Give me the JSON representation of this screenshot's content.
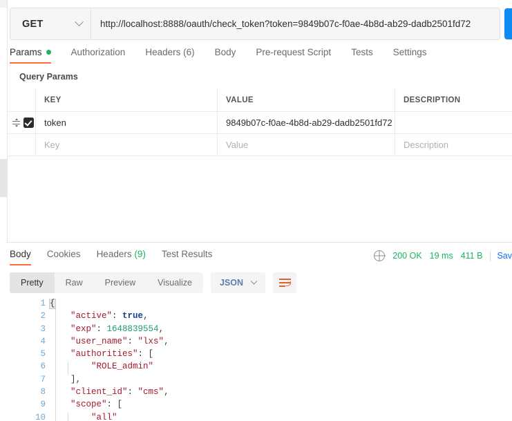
{
  "request": {
    "method": "GET",
    "method_icon": "chevron-down-icon",
    "url": "http://localhost:8888/oauth/check_token?token=9849b07c-f0ae-4b8d-ab29-dadb2501fd72",
    "send_label": "",
    "tabs": [
      {
        "label": "Params",
        "active": true,
        "indicator": "green-dot"
      },
      {
        "label": "Authorization",
        "active": false
      },
      {
        "label": "Headers (6)",
        "active": false
      },
      {
        "label": "Body",
        "active": false
      },
      {
        "label": "Pre-request Script",
        "active": false
      },
      {
        "label": "Tests",
        "active": false
      },
      {
        "label": "Settings",
        "active": false
      }
    ],
    "section_title": "Query Params",
    "params_table": {
      "columns": [
        "KEY",
        "VALUE",
        "DESCRIPTION"
      ],
      "rows": [
        {
          "checked": true,
          "key": "token",
          "value": "9849b07c-f0ae-4b8d-ab29-dadb2501fd72",
          "description": ""
        }
      ],
      "placeholder_row": {
        "key": "Key",
        "value": "Value",
        "description": "Description"
      }
    }
  },
  "response": {
    "tabs": [
      {
        "label": "Body",
        "active": true
      },
      {
        "label": "Cookies",
        "active": false
      },
      {
        "label": "Headers",
        "count": " (9)",
        "active": false
      },
      {
        "label": "Test Results",
        "active": false
      }
    ],
    "status": "200 OK",
    "time": "19 ms",
    "size": "411 B",
    "save_label": "Sav",
    "globe_icon": "globe-icon",
    "view_modes": [
      {
        "label": "Pretty",
        "active": true
      },
      {
        "label": "Raw",
        "active": false
      },
      {
        "label": "Preview",
        "active": false
      },
      {
        "label": "Visualize",
        "active": false
      }
    ],
    "format": "JSON",
    "wrap_icon": "word-wrap-icon",
    "body_lines": [
      {
        "n": "1",
        "indent": 0,
        "tokens": [
          {
            "t": "brace",
            "v": "{"
          }
        ]
      },
      {
        "n": "2",
        "indent": 1,
        "tokens": [
          {
            "t": "k",
            "v": "\"active\""
          },
          {
            "t": "p",
            "v": ": "
          },
          {
            "t": "bool",
            "v": "true"
          },
          {
            "t": "p",
            "v": ","
          }
        ]
      },
      {
        "n": "3",
        "indent": 1,
        "tokens": [
          {
            "t": "k",
            "v": "\"exp\""
          },
          {
            "t": "p",
            "v": ": "
          },
          {
            "t": "num",
            "v": "1648839554"
          },
          {
            "t": "p",
            "v": ","
          }
        ]
      },
      {
        "n": "4",
        "indent": 1,
        "tokens": [
          {
            "t": "k",
            "v": "\"user_name\""
          },
          {
            "t": "p",
            "v": ": "
          },
          {
            "t": "s",
            "v": "\"lxs\""
          },
          {
            "t": "p",
            "v": ","
          }
        ]
      },
      {
        "n": "5",
        "indent": 1,
        "tokens": [
          {
            "t": "k",
            "v": "\"authorities\""
          },
          {
            "t": "p",
            "v": ": ["
          }
        ]
      },
      {
        "n": "6",
        "indent": 2,
        "guide": true,
        "tokens": [
          {
            "t": "s",
            "v": "\"ROLE_admin\""
          }
        ]
      },
      {
        "n": "7",
        "indent": 1,
        "tokens": [
          {
            "t": "p",
            "v": "],"
          }
        ]
      },
      {
        "n": "8",
        "indent": 1,
        "tokens": [
          {
            "t": "k",
            "v": "\"client_id\""
          },
          {
            "t": "p",
            "v": ": "
          },
          {
            "t": "s",
            "v": "\"cms\""
          },
          {
            "t": "p",
            "v": ","
          }
        ]
      },
      {
        "n": "9",
        "indent": 1,
        "tokens": [
          {
            "t": "k",
            "v": "\"scope\""
          },
          {
            "t": "p",
            "v": ": ["
          }
        ]
      },
      {
        "n": "10",
        "indent": 2,
        "guide": true,
        "tokens": [
          {
            "t": "s",
            "v": "\"all\""
          }
        ]
      }
    ]
  },
  "colors": {
    "accent": "#ff6c37",
    "success": "#1bb55c",
    "link": "#0d6efd",
    "send": "#0d8bf2"
  }
}
